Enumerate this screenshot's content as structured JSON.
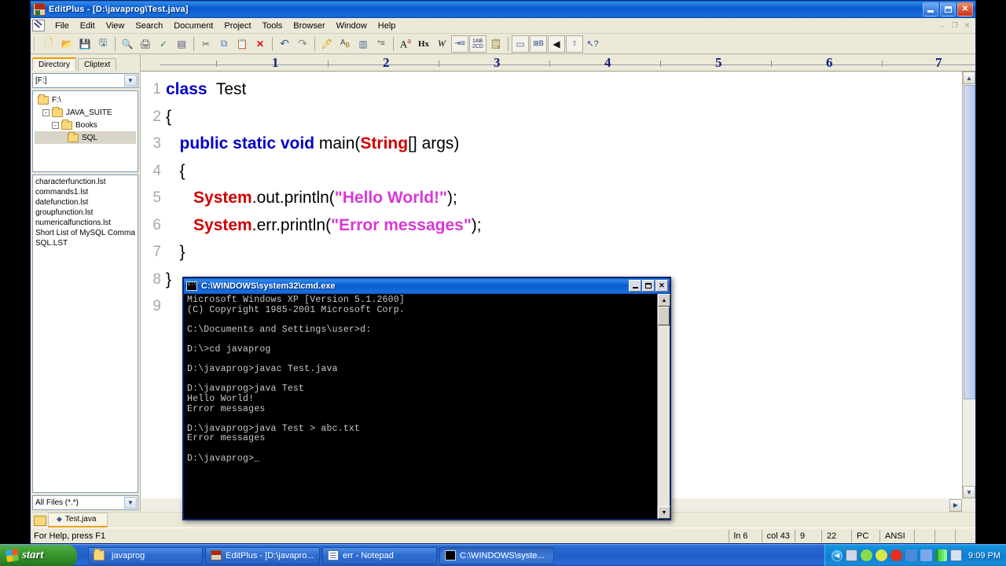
{
  "window": {
    "title": "EditPlus - [D:\\javaprog\\Test.java]",
    "minimize_label": "Minimize",
    "maximize_label": "Maximize",
    "close_label": "Close"
  },
  "menu": {
    "items": [
      "File",
      "Edit",
      "View",
      "Search",
      "Document",
      "Project",
      "Tools",
      "Browser",
      "Window",
      "Help"
    ],
    "mdi": [
      "–",
      "❐",
      "✕"
    ]
  },
  "toolbar": {
    "buttons": [
      {
        "name": "new-file",
        "glyph": "🗎"
      },
      {
        "name": "open-file",
        "glyph": "📂"
      },
      {
        "name": "save-file",
        "glyph": "💾"
      },
      {
        "name": "save-all",
        "glyph": "🖫"
      },
      {
        "name": "print-preview",
        "glyph": "🔍"
      },
      {
        "name": "print",
        "glyph": "🖨"
      },
      {
        "name": "spell-check",
        "glyph": "✓"
      },
      {
        "name": "page-setup",
        "glyph": "▤"
      },
      {
        "name": "cut",
        "glyph": "✂"
      },
      {
        "name": "copy",
        "glyph": "⧉"
      },
      {
        "name": "paste",
        "glyph": "📋"
      },
      {
        "name": "delete",
        "glyph": "✕"
      },
      {
        "name": "undo",
        "glyph": "↶"
      },
      {
        "name": "redo",
        "glyph": "↷"
      },
      {
        "name": "highlight",
        "glyph": "🖊"
      },
      {
        "name": "sort",
        "glyph": "A₂"
      },
      {
        "name": "document-properties",
        "glyph": "▥"
      },
      {
        "name": "line-numbers",
        "glyph": "≣"
      },
      {
        "name": "font-size",
        "glyph": "Aᵃ"
      },
      {
        "name": "hex-view",
        "glyph": "Hx"
      },
      {
        "name": "word-wrap",
        "glyph": "W"
      },
      {
        "name": "indent",
        "glyph": "≡"
      },
      {
        "name": "ascii-table",
        "glyph": "▒"
      },
      {
        "name": "user-tools",
        "glyph": "⚙"
      },
      {
        "name": "view-window",
        "glyph": "▭"
      },
      {
        "name": "browser-preview",
        "glyph": "⊞"
      },
      {
        "name": "run-applet",
        "glyph": "◀"
      },
      {
        "name": "ftp-upload",
        "glyph": "↑"
      },
      {
        "name": "context-help",
        "glyph": "❓"
      }
    ]
  },
  "sidebar": {
    "tabs": [
      {
        "label": "Directory",
        "active": true
      },
      {
        "label": "Cliptext",
        "active": false
      }
    ],
    "drive_value": "[F:]",
    "tree": [
      {
        "label": "F:\\",
        "depth": 0,
        "expander": "",
        "selected": false
      },
      {
        "label": "JAVA_SUITE",
        "depth": 1,
        "expander": "-",
        "selected": false
      },
      {
        "label": "Books",
        "depth": 2,
        "expander": "-",
        "selected": false
      },
      {
        "label": "SQL",
        "depth": 3,
        "expander": "",
        "selected": true
      }
    ],
    "files": [
      "characterfunction.lst",
      "commands1.lst",
      "datefunction.lst",
      "groupfunction.lst",
      "numericalfunctions.lst",
      "Short List of MySQL Commar",
      "SQL.LST"
    ],
    "filter_value": "All Files (*.*)"
  },
  "editor": {
    "ruler_numbers": [
      "1",
      "2",
      "3",
      "4",
      "5",
      "6",
      "7"
    ],
    "line_numbers": [
      "1",
      "2",
      "3",
      "4",
      "5",
      "6",
      "7",
      "8",
      "9"
    ],
    "lines": [
      [
        {
          "t": "class",
          "c": "kw"
        },
        {
          "t": "  Test",
          "c": "pln"
        }
      ],
      [
        {
          "t": "{",
          "c": "pln"
        }
      ],
      [
        {
          "t": "   ",
          "c": "pln"
        },
        {
          "t": "public static void",
          "c": "kw"
        },
        {
          "t": " main(",
          "c": "pln"
        },
        {
          "t": "String",
          "c": "cls"
        },
        {
          "t": "[] args)",
          "c": "pln"
        }
      ],
      [
        {
          "t": "   {",
          "c": "pln"
        }
      ],
      [
        {
          "t": "      ",
          "c": "pln"
        },
        {
          "t": "System",
          "c": "cls"
        },
        {
          "t": ".out.println(",
          "c": "pln"
        },
        {
          "t": "\"Hello World!\"",
          "c": "str"
        },
        {
          "t": ");",
          "c": "pln"
        }
      ],
      [
        {
          "t": "      ",
          "c": "pln"
        },
        {
          "t": "System",
          "c": "cls"
        },
        {
          "t": ".err.println(",
          "c": "pln"
        },
        {
          "t": "\"Error messages\"",
          "c": "str"
        },
        {
          "t": ");",
          "c": "pln"
        }
      ],
      [
        {
          "t": "   }",
          "c": "pln"
        }
      ],
      [
        {
          "t": "}",
          "c": "pln"
        }
      ],
      [
        {
          "t": "",
          "c": "pln"
        }
      ]
    ],
    "document_tab": "Test.java"
  },
  "statusbar": {
    "help_text": "For Help, press F1",
    "cells": [
      "ln 6",
      "col 43",
      "9",
      "22",
      "PC",
      "ANSI",
      "",
      "",
      ""
    ]
  },
  "cmd": {
    "title": "C:\\WINDOWS\\system32\\cmd.exe",
    "lines": [
      "Microsoft Windows XP [Version 5.1.2600]",
      "(C) Copyright 1985-2001 Microsoft Corp.",
      "",
      "C:\\Documents and Settings\\user>d:",
      "",
      "D:\\>cd javaprog",
      "",
      "D:\\javaprog>javac Test.java",
      "",
      "D:\\javaprog>java Test",
      "Hello World!",
      "Error messages",
      "",
      "D:\\javaprog>java Test > abc.txt",
      "Error messages",
      "",
      "D:\\javaprog>_"
    ]
  },
  "taskbar": {
    "start_label": "start",
    "tasks": [
      {
        "label": "javaprog",
        "icon": "folder",
        "active": false
      },
      {
        "label": "EditPlus - [D:\\javapro...",
        "icon": "edit",
        "active": false
      },
      {
        "label": "err - Notepad",
        "icon": "note",
        "active": false
      },
      {
        "label": "C:\\WINDOWS\\syste...",
        "icon": "cmd",
        "active": true
      }
    ],
    "tray_icons": [
      {
        "name": "display-properties-icon",
        "color": "#cfd8e8"
      },
      {
        "name": "volume-icon",
        "color": "#8adb4a"
      },
      {
        "name": "update-icon",
        "color": "#d8e84a"
      },
      {
        "name": "security-alert-icon",
        "color": "#e03020"
      },
      {
        "name": "network-icon",
        "color": "#4a8ad8"
      },
      {
        "name": "network-activity-icon",
        "color": "#7aa8e8"
      },
      {
        "name": "signal-bars-icon",
        "color": "#4ad84a"
      },
      {
        "name": "messenger-icon",
        "color": "#d8e0f0"
      }
    ],
    "time": "9:09 PM"
  },
  "colors": {
    "keyword": "#0000c8",
    "class": "#d00000",
    "string": "#d838d8",
    "titlebar": "#0a5ad2",
    "chrome": "#ece9d8"
  }
}
